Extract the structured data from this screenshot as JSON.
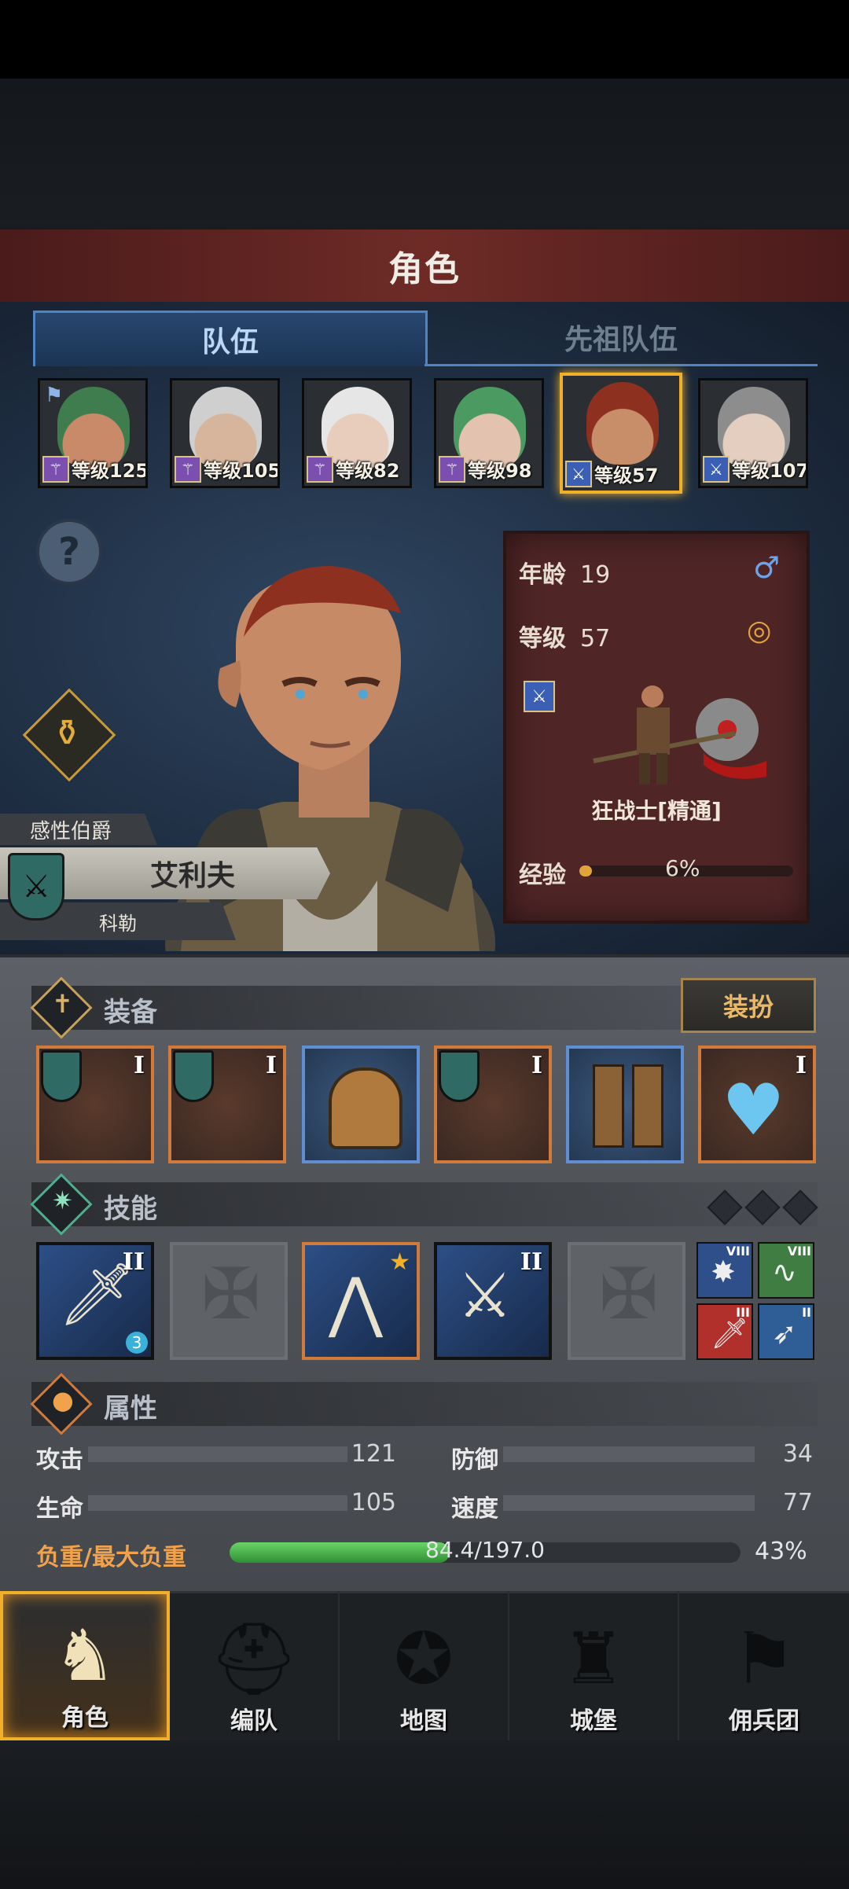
{
  "title": "角色",
  "tabs": [
    {
      "label": "队伍"
    },
    {
      "label": "先祖队伍"
    }
  ],
  "roster": [
    {
      "level": "等级125",
      "class": "purple",
      "hair": "#3f7d4f",
      "skin": "#c98a6a",
      "flag": true
    },
    {
      "level": "等级105",
      "class": "purple",
      "hair": "#cfcfcf",
      "skin": "#d7b59d",
      "flag": false
    },
    {
      "level": "等级82",
      "class": "purple",
      "hair": "#e6e6e6",
      "skin": "#e8cdbd",
      "flag": false
    },
    {
      "level": "等级98",
      "class": "purple",
      "hair": "#4b9a62",
      "skin": "#e3c3b0",
      "flag": false
    },
    {
      "level": "等级57",
      "class": "blue",
      "hair": "#8e3020",
      "skin": "#c88e6a",
      "flag": false
    },
    {
      "level": "等级107",
      "class": "blue",
      "hair": "#8d8d8d",
      "skin": "#e4cec0",
      "flag": false
    }
  ],
  "hero": {
    "title": "感性伯爵",
    "name": "艾利夫",
    "family": "科勒"
  },
  "stats_card": {
    "age_label": "年龄",
    "age": "19",
    "level_label": "等级",
    "level": "57",
    "job": "狂战士[精通]",
    "exp_label": "经验",
    "exp_pct": "6%",
    "exp_fraction": 0.06,
    "gender_icon": "male-icon",
    "ring_icon": "ring-icon"
  },
  "equipment": {
    "title": "装备",
    "dress_button": "装扮",
    "slots": [
      {
        "tier": "I",
        "rarity": "orange"
      },
      {
        "tier": "I",
        "rarity": "orange"
      },
      {
        "tier": "",
        "rarity": "blue"
      },
      {
        "tier": "I",
        "rarity": "orange"
      },
      {
        "tier": "",
        "rarity": "blue"
      },
      {
        "tier": "I",
        "rarity": "orange"
      }
    ]
  },
  "skills": {
    "title": "技能",
    "slots": [
      {
        "tier": "II",
        "badge": "3"
      },
      {
        "tier": "",
        "badge": ""
      },
      {
        "tier": "",
        "badge": ""
      },
      {
        "tier": "II",
        "badge": ""
      },
      {
        "tier": "",
        "badge": ""
      }
    ],
    "passives": [
      {
        "tier": "VIII",
        "color": "#2f4f8a"
      },
      {
        "tier": "VIII",
        "color": "#3f7d42"
      },
      {
        "tier": "III",
        "color": "#b1302b"
      },
      {
        "tier": "II",
        "color": "#2f5d96"
      }
    ]
  },
  "attributes": {
    "title": "属性",
    "attack_label": "攻击",
    "attack": "121",
    "defense_label": "防御",
    "defense": "34",
    "hp_label": "生命",
    "hp": "105",
    "speed_label": "速度",
    "speed": "77",
    "load_label": "负重/最大负重",
    "load_text": "84.4/197.0",
    "load_pct": "43%",
    "load_fraction": 0.43
  },
  "nav": [
    {
      "label": "角色",
      "active": true
    },
    {
      "label": "编队",
      "active": false
    },
    {
      "label": "地图",
      "active": false
    },
    {
      "label": "城堡",
      "active": false
    },
    {
      "label": "佣兵团",
      "active": false
    }
  ],
  "colors": {
    "accent": "#f0b02a",
    "tab": "#4e84c4",
    "card": "#4f2526",
    "load": "#4fbf52"
  }
}
